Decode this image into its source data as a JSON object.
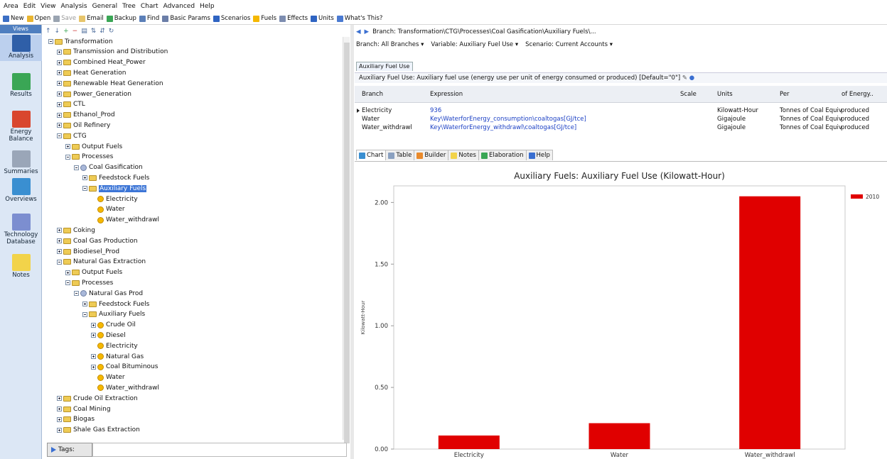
{
  "menu": [
    "Area",
    "Edit",
    "View",
    "Analysis",
    "General",
    "Tree",
    "Chart",
    "Advanced",
    "Help"
  ],
  "toolbar": [
    {
      "label": "New",
      "icon": "new-icon",
      "color": "#3c6fc4",
      "enabled": true
    },
    {
      "label": "Open",
      "icon": "open-icon",
      "color": "#e9b530",
      "enabled": true
    },
    {
      "label": "Save",
      "icon": "save-icon",
      "color": "#9aa4b1",
      "enabled": false
    },
    {
      "label": "Email",
      "icon": "email-icon",
      "color": "#e7c56b",
      "enabled": true
    },
    {
      "label": "Backup",
      "icon": "backup-icon",
      "color": "#3aa655",
      "enabled": true
    },
    {
      "label": "Find",
      "icon": "find-icon",
      "color": "#5b7fb8",
      "enabled": true
    },
    {
      "label": "Basic Params",
      "icon": "basic-params-icon",
      "color": "#6b7ea8",
      "enabled": true
    },
    {
      "label": "Scenarios",
      "icon": "scenarios-icon",
      "color": "#2f64c2",
      "enabled": true
    },
    {
      "label": "Fuels",
      "icon": "fuels-icon",
      "color": "#f5b800",
      "enabled": true
    },
    {
      "label": "Effects",
      "icon": "effects-icon",
      "color": "#7d8db0",
      "enabled": true
    },
    {
      "label": "Units",
      "icon": "units-icon",
      "color": "#2f64c2",
      "enabled": true
    },
    {
      "label": "What's This?",
      "icon": "whats-this-icon",
      "color": "#4a7ad1",
      "enabled": true
    }
  ],
  "sidebar": {
    "header": "Views",
    "items": [
      {
        "label": "Analysis",
        "icon": "analysis-icon",
        "color": "#2f5fa8",
        "active": true
      },
      {
        "label": "Results",
        "icon": "results-icon",
        "color": "#3aa655",
        "active": false
      },
      {
        "label": "Energy Balance",
        "icon": "energy-balance-icon",
        "color": "#d9462e",
        "active": false
      },
      {
        "label": "Summaries",
        "icon": "summaries-icon",
        "color": "#9aa6b8",
        "active": false
      },
      {
        "label": "Overviews",
        "icon": "overviews-icon",
        "color": "#3a8fd1",
        "active": false
      },
      {
        "label": "Technology Database",
        "icon": "technology-database-icon",
        "color": "#7c8ed0",
        "active": false
      },
      {
        "label": "Notes",
        "icon": "notes-icon",
        "color": "#f2d34a",
        "active": false
      }
    ]
  },
  "tree": [
    {
      "label": "Transformation",
      "lvl": 0,
      "type": "folder",
      "exp": "minus"
    },
    {
      "label": "Transmission and Distribution",
      "lvl": 1,
      "type": "folder",
      "exp": "plus"
    },
    {
      "label": "Combined Heat_Power",
      "lvl": 1,
      "type": "folder",
      "exp": "plus"
    },
    {
      "label": "Heat Generation",
      "lvl": 1,
      "type": "folder",
      "exp": "plus"
    },
    {
      "label": "Renewable Heat Generation",
      "lvl": 1,
      "type": "folder",
      "exp": "plus"
    },
    {
      "label": "Power_Generation",
      "lvl": 1,
      "type": "folder",
      "exp": "plus"
    },
    {
      "label": "CTL",
      "lvl": 1,
      "type": "folder",
      "exp": "plus"
    },
    {
      "label": "Ethanol_Prod",
      "lvl": 1,
      "type": "folder",
      "exp": "plus"
    },
    {
      "label": "Oil Refinery",
      "lvl": 1,
      "type": "folder",
      "exp": "plus"
    },
    {
      "label": "CTG",
      "lvl": 1,
      "type": "folder",
      "exp": "minus"
    },
    {
      "label": "Output Fuels",
      "lvl": 2,
      "type": "folder",
      "exp": "plus"
    },
    {
      "label": "Processes",
      "lvl": 2,
      "type": "folder",
      "exp": "minus"
    },
    {
      "label": "Coal Gasification",
      "lvl": 3,
      "type": "process",
      "exp": "minus"
    },
    {
      "label": "Feedstock Fuels",
      "lvl": 4,
      "type": "folder",
      "exp": "plus"
    },
    {
      "label": "Auxiliary Fuels",
      "lvl": 4,
      "type": "folder",
      "exp": "minus",
      "selected": true
    },
    {
      "label": "Electricity",
      "lvl": 5,
      "type": "fuel",
      "exp": "none"
    },
    {
      "label": "Water",
      "lvl": 5,
      "type": "fuel",
      "exp": "none"
    },
    {
      "label": "Water_withdrawl",
      "lvl": 5,
      "type": "fuel",
      "exp": "none"
    },
    {
      "label": "Coking",
      "lvl": 1,
      "type": "folder",
      "exp": "plus"
    },
    {
      "label": "Coal Gas Production",
      "lvl": 1,
      "type": "folder",
      "exp": "plus"
    },
    {
      "label": "Biodiesel_Prod",
      "lvl": 1,
      "type": "folder",
      "exp": "plus"
    },
    {
      "label": "Natural Gas Extraction",
      "lvl": 1,
      "type": "folder",
      "exp": "minus"
    },
    {
      "label": "Output Fuels",
      "lvl": 2,
      "type": "folder",
      "exp": "plus"
    },
    {
      "label": "Processes",
      "lvl": 2,
      "type": "folder",
      "exp": "minus"
    },
    {
      "label": "Natural Gas Prod",
      "lvl": 3,
      "type": "process",
      "exp": "minus"
    },
    {
      "label": "Feedstock Fuels",
      "lvl": 4,
      "type": "folder",
      "exp": "plus"
    },
    {
      "label": "Auxiliary Fuels",
      "lvl": 4,
      "type": "folder",
      "exp": "minus"
    },
    {
      "label": "Crude Oil",
      "lvl": 5,
      "type": "fuel",
      "exp": "plus"
    },
    {
      "label": "Diesel",
      "lvl": 5,
      "type": "fuel",
      "exp": "plus"
    },
    {
      "label": "Electricity",
      "lvl": 5,
      "type": "fuel",
      "exp": "none"
    },
    {
      "label": "Natural Gas",
      "lvl": 5,
      "type": "fuel",
      "exp": "plus"
    },
    {
      "label": "Coal Bituminous",
      "lvl": 5,
      "type": "fuel",
      "exp": "plus"
    },
    {
      "label": "Water",
      "lvl": 5,
      "type": "fuel",
      "exp": "none"
    },
    {
      "label": "Water_withdrawl",
      "lvl": 5,
      "type": "fuel",
      "exp": "none"
    },
    {
      "label": "Crude Oil Extraction",
      "lvl": 1,
      "type": "folder",
      "exp": "plus"
    },
    {
      "label": "Coal Mining",
      "lvl": 1,
      "type": "folder",
      "exp": "plus"
    },
    {
      "label": "Biogas",
      "lvl": 1,
      "type": "folder",
      "exp": "plus"
    },
    {
      "label": "Shale Gas Extraction",
      "lvl": 1,
      "type": "folder",
      "exp": "plus"
    }
  ],
  "tags_label": "Tags:",
  "nav": {
    "path": "Branch: Transformation\\CTG\\Processes\\Coal Gasification\\Auxiliary Fuels\\..."
  },
  "filters": {
    "branch": "Branch: All Branches",
    "variable": "Variable: Auxiliary Fuel Use",
    "scenario": "Scenario: Current Accounts"
  },
  "variable_tab": "Auxiliary Fuel Use",
  "description": "Auxiliary Fuel Use: Auxiliary fuel use (energy use per unit of energy consumed or produced) [Default=\"0\"]",
  "grid": {
    "columns": [
      "Branch",
      "Expression",
      "Scale",
      "Units",
      "Per",
      "of Energy.."
    ],
    "rows": [
      {
        "branch": "Electricity",
        "expression": "936",
        "scale": "",
        "units": "Kilowatt-Hour",
        "per": "Tonnes of Coal Equiv",
        "of": "produced"
      },
      {
        "branch": "Water",
        "expression": "Key\\WaterforEnergy_consumption\\coaltogas[GJ/tce]",
        "scale": "",
        "units": "Gigajoule",
        "per": "Tonnes of Coal Equiv",
        "of": "produced"
      },
      {
        "branch": "Water_withdrawl",
        "expression": "Key\\WaterforEnergy_withdrawl\\coaltogas[GJ/tce]",
        "scale": "",
        "units": "Gigajoule",
        "per": "Tonnes of Coal Equiv",
        "of": "produced"
      }
    ]
  },
  "bottom_tabs": [
    {
      "label": "Chart",
      "icon": "chart-tab-icon",
      "color": "#3a8fd1",
      "active": true
    },
    {
      "label": "Table",
      "icon": "table-tab-icon",
      "color": "#8aa0c0",
      "active": false
    },
    {
      "label": "Builder",
      "icon": "builder-tab-icon",
      "color": "#e98a2b",
      "active": false
    },
    {
      "label": "Notes",
      "icon": "notes-tab-icon",
      "color": "#f2d34a",
      "active": false
    },
    {
      "label": "Elaboration",
      "icon": "elaboration-tab-icon",
      "color": "#3aa655",
      "active": false
    },
    {
      "label": "Help",
      "icon": "help-tab-icon",
      "color": "#3a6fd1",
      "active": false
    }
  ],
  "chart_data": {
    "type": "bar",
    "title": "Auxiliary Fuels: Auxiliary Fuel Use (Kilowatt-Hour)",
    "ylabel": "Kilowatt-Hour",
    "xlabel": "",
    "categories": [
      "Electricity",
      "Water",
      "Water_withdrawl"
    ],
    "series": [
      {
        "name": "2010",
        "color": "#e00000",
        "values": [
          0.11,
          0.21,
          2.05
        ]
      }
    ],
    "yticks": [
      0.0,
      0.5,
      1.0,
      1.5,
      2.0
    ],
    "ytick_labels": [
      "0.00",
      "0.50",
      "1.00",
      "1.50",
      "2.00"
    ],
    "ylim": [
      0,
      2.1
    ],
    "grid": false,
    "legend": "top-right"
  }
}
